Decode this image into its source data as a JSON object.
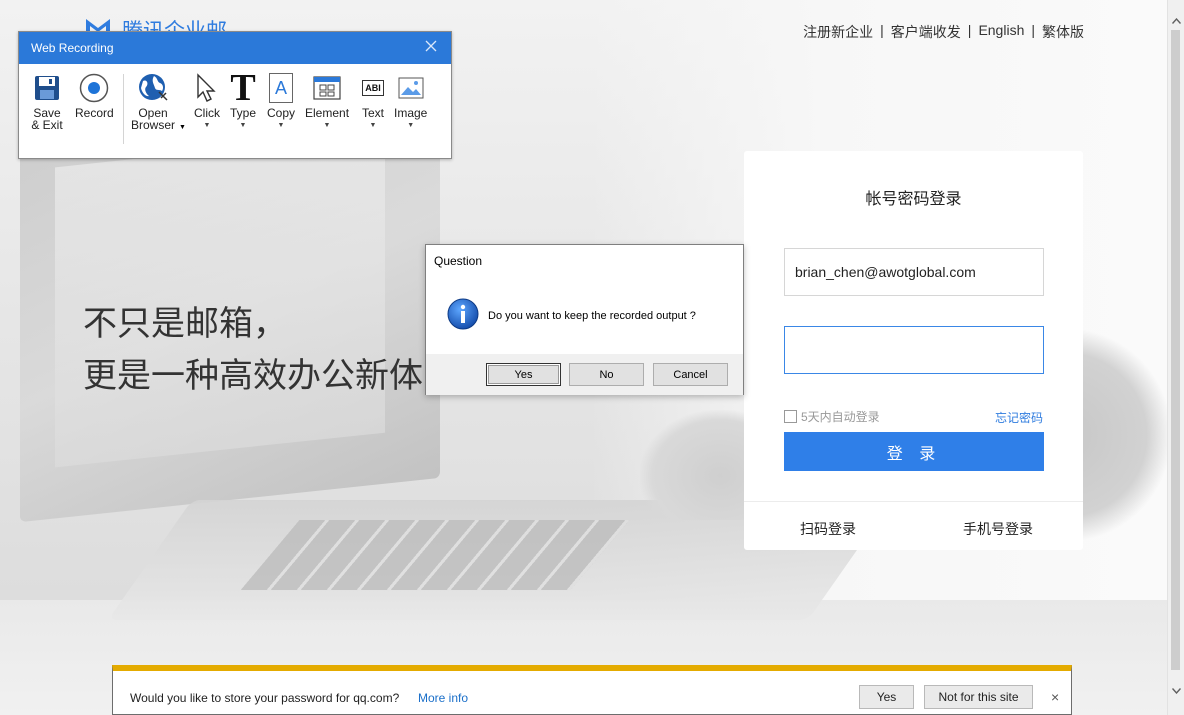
{
  "page": {
    "logo_text": "腾讯企业邮",
    "top_links": [
      "注册新企业",
      "客户端收发",
      "English",
      "繁体版"
    ],
    "link_separator": "|",
    "hero_line1": "不只是邮箱，",
    "hero_line2": "更是一种高效办公新体"
  },
  "login": {
    "title": "帐号密码登录",
    "email_value": "brian_chen@awotglobal.com",
    "password_value": "",
    "remember_label": "5天内自动登录",
    "forgot_label": "忘记密码",
    "login_button": "登 录",
    "qr_login": "扫码登录",
    "phone_login": "手机号登录",
    "accent_color": "#2f7fe8"
  },
  "recording": {
    "title": "Web Recording",
    "tools": [
      {
        "line1": "Save",
        "line2": "& Exit",
        "icon": "save-icon"
      },
      {
        "line1": "Record",
        "line2": "",
        "icon": "record-icon"
      },
      {
        "line1": "Open",
        "line2": "Browser",
        "icon": "globe-icon"
      },
      {
        "line1": "Click",
        "line2": "",
        "icon": "cursor-icon"
      },
      {
        "line1": "Type",
        "line2": "",
        "icon": "type-icon"
      },
      {
        "line1": "Copy",
        "line2": "",
        "icon": "copy-icon"
      },
      {
        "line1": "Element",
        "line2": "",
        "icon": "element-icon"
      },
      {
        "line1": "Text",
        "line2": "",
        "icon": "text-icon"
      },
      {
        "line1": "Image",
        "line2": "",
        "icon": "image-icon"
      }
    ],
    "type_glyph": "T",
    "copy_glyph": "A",
    "text_glyph": "ABI",
    "titlebar_color": "#2b79d9"
  },
  "dialog": {
    "title": "Question",
    "message": "Do you want to keep the recorded output ?",
    "yes": "Yes",
    "no": "No",
    "cancel": "Cancel"
  },
  "password_bar": {
    "message": "Would you like to store your password for qq.com?",
    "more_info": "More info",
    "yes": "Yes",
    "not_for_site": "Not for this site",
    "close": "×",
    "accent_color": "#e4ab00"
  }
}
